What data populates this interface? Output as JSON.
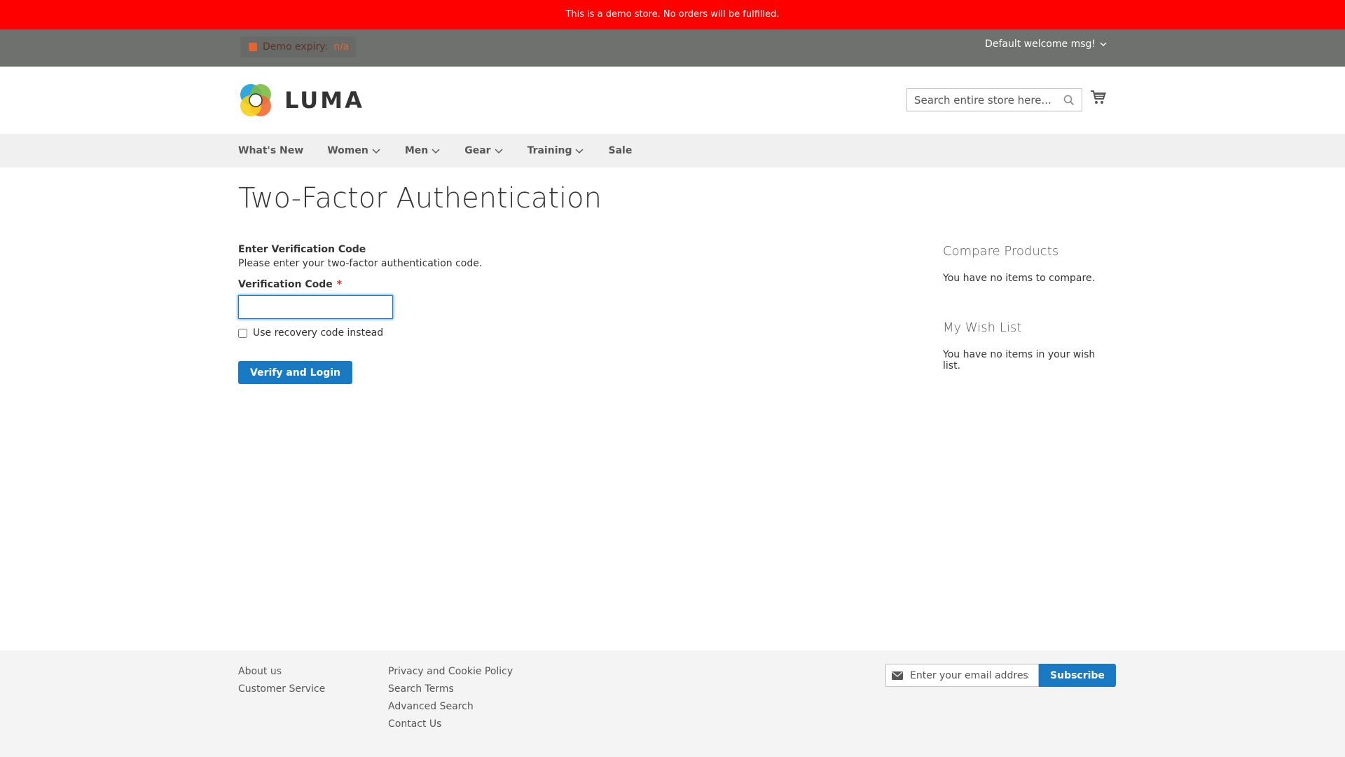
{
  "banner": {
    "text": "This is a demo store. No orders will be fulfilled."
  },
  "header": {
    "demo_expiry_label": "Demo expiry:",
    "demo_expiry_value": "n/a",
    "welcome": "Default welcome msg!"
  },
  "logo": {
    "text": "LUMA"
  },
  "search": {
    "placeholder": "Search entire store here..."
  },
  "nav": {
    "items": [
      {
        "label": "What's New",
        "has_dropdown": false
      },
      {
        "label": "Women",
        "has_dropdown": true
      },
      {
        "label": "Men",
        "has_dropdown": true
      },
      {
        "label": "Gear",
        "has_dropdown": true
      },
      {
        "label": "Training",
        "has_dropdown": true
      },
      {
        "label": "Sale",
        "has_dropdown": false
      }
    ]
  },
  "page": {
    "title": "Two-Factor Authentication"
  },
  "form": {
    "section_title": "Enter Verification Code",
    "description": "Please enter your two-factor authentication code.",
    "code_label": "Verification Code",
    "required_mark": "*",
    "code_value": "",
    "recovery_label": "Use recovery code instead",
    "submit_label": "Verify and Login"
  },
  "sidebar": {
    "compare_title": "Compare Products",
    "compare_text": "You have no items to compare.",
    "wishlist_title": "My Wish List",
    "wishlist_text": "You have no items in your wish list."
  },
  "footer": {
    "col1": [
      "About us",
      "Customer Service"
    ],
    "col2": [
      "Privacy and Cookie Policy",
      "Search Terms",
      "Advanced Search",
      "Contact Us"
    ],
    "newsletter_placeholder": "Enter your email address",
    "subscribe_label": "Subscribe"
  },
  "colors": {
    "banner": "#ff0000",
    "panel": "#6e716e",
    "primary": "#1979c3",
    "required": "#e02b27"
  }
}
